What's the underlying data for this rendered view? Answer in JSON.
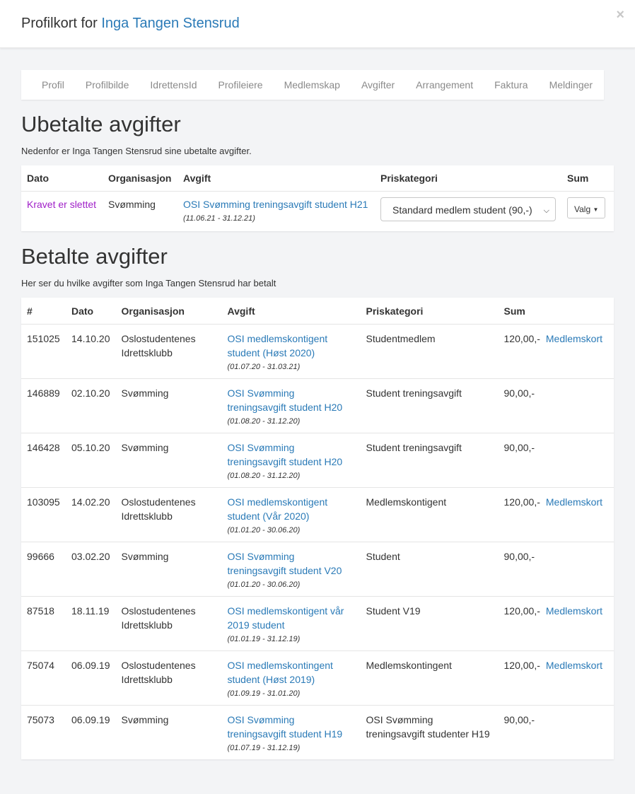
{
  "header": {
    "title_prefix": "Profilkort for",
    "name": "Inga Tangen Stensrud",
    "close": "×"
  },
  "tabs": [
    "Profil",
    "Profilbilde",
    "IdrettensId",
    "Profileiere",
    "Medlemskap",
    "Avgifter",
    "Arrangement",
    "Faktura",
    "Meldinger"
  ],
  "unpaid": {
    "title": "Ubetalte avgifter",
    "desc": "Nedenfor er Inga Tangen Stensrud sine ubetalte avgifter.",
    "headers": [
      "Dato",
      "Organisasjon",
      "Avgift",
      "Priskategori",
      "Sum"
    ],
    "row": {
      "status": "Kravet er slettet",
      "org": "Svømming",
      "fee": "OSI Svømming treningsavgift student H21",
      "period": "(11.06.21 - 31.12.21)",
      "price_category": "Standard medlem student (90,-)",
      "valg": "Valg"
    }
  },
  "paid": {
    "title": "Betalte avgifter",
    "desc": "Her ser du hvilke avgifter som Inga Tangen Stensrud har betalt",
    "headers": [
      "#",
      "Dato",
      "Organisasjon",
      "Avgift",
      "Priskategori",
      "Sum",
      ""
    ],
    "rows": [
      {
        "id": "151025",
        "date": "14.10.20",
        "org": "Oslostudentenes Idrettsklubb",
        "fee": "OSI medlemskontigent student (Høst 2020)",
        "period": "(01.07.20 - 31.03.21)",
        "cat": "Studentmedlem",
        "sum": "120,00,-",
        "link": "Medlemskort"
      },
      {
        "id": "146889",
        "date": "02.10.20",
        "org": "Svømming",
        "fee": "OSI Svømming treningsavgift student H20",
        "period": "(01.08.20 - 31.12.20)",
        "cat": "Student treningsavgift",
        "sum": "90,00,-",
        "link": ""
      },
      {
        "id": "146428",
        "date": "05.10.20",
        "org": "Svømming",
        "fee": "OSI Svømming treningsavgift student H20",
        "period": "(01.08.20 - 31.12.20)",
        "cat": "Student treningsavgift",
        "sum": "90,00,-",
        "link": ""
      },
      {
        "id": "103095",
        "date": "14.02.20",
        "org": "Oslostudentenes Idrettsklubb",
        "fee": "OSI medlemskontigent student (Vår 2020)",
        "period": "(01.01.20 - 30.06.20)",
        "cat": "Medlemskontigent",
        "sum": "120,00,-",
        "link": "Medlemskort"
      },
      {
        "id": "99666",
        "date": "03.02.20",
        "org": "Svømming",
        "fee": "OSI Svømming treningsavgift student V20",
        "period": "(01.01.20 - 30.06.20)",
        "cat": "Student",
        "sum": "90,00,-",
        "link": ""
      },
      {
        "id": "87518",
        "date": "18.11.19",
        "org": "Oslostudentenes Idrettsklubb",
        "fee": "OSI medlemskontigent vår 2019 student",
        "period": "(01.01.19 - 31.12.19)",
        "cat": "Student V19",
        "sum": "120,00,-",
        "link": "Medlemskort"
      },
      {
        "id": "75074",
        "date": "06.09.19",
        "org": "Oslostudentenes Idrettsklubb",
        "fee": "OSI medlemskontingent student (Høst 2019)",
        "period": "(01.09.19 - 31.01.20)",
        "cat": "Medlemskontingent",
        "sum": "120,00,-",
        "link": "Medlemskort"
      },
      {
        "id": "75073",
        "date": "06.09.19",
        "org": "Svømming",
        "fee": "OSI Svømming treningsavgift student H19",
        "period": "(01.07.19 - 31.12.19)",
        "cat": "OSI Svømming treningsavgift studenter H19",
        "sum": "90,00,-",
        "link": ""
      }
    ]
  },
  "colors": {
    "link": "#2a7ab7",
    "deleted": "#a020c8",
    "background": "#f3f4f6"
  }
}
